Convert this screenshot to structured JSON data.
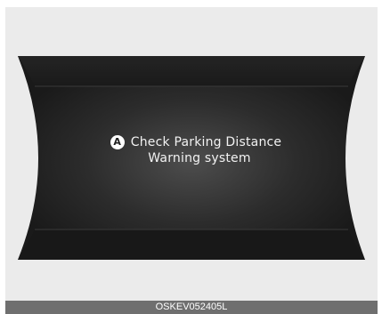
{
  "display": {
    "marker_label": "A",
    "message_line1": "Check Parking Distance",
    "message_line2": "Warning system"
  },
  "figure": {
    "caption": "OSKEV052405L"
  },
  "colors": {
    "background": "#ebebeb",
    "panel_dark": "#1c1c1c",
    "panel_mid": "#4a4a4a",
    "text": "#f2f2f2",
    "caption_bar": "#6f6f6f"
  },
  "icons": {
    "marker": "circled-letter-a-icon"
  }
}
